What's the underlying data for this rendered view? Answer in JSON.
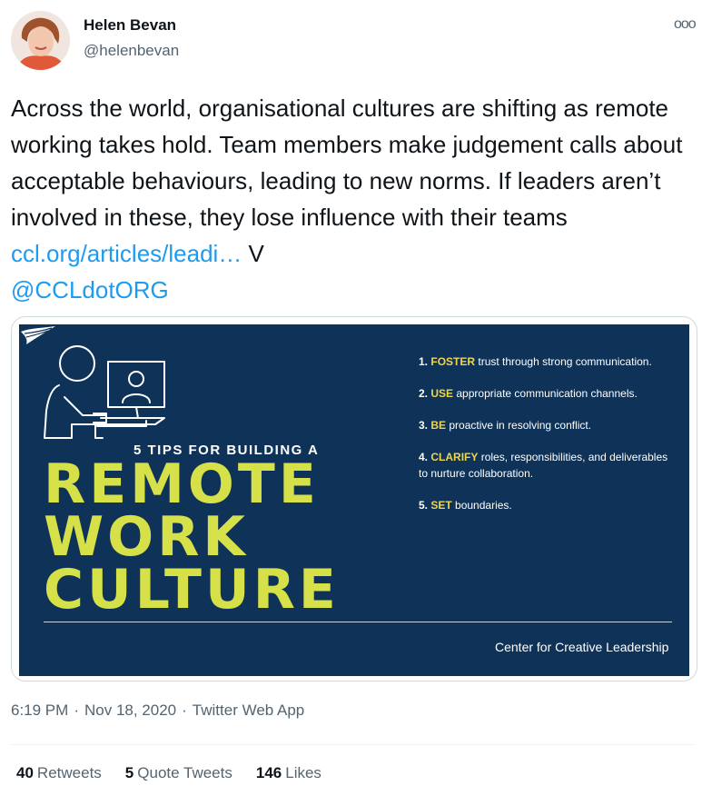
{
  "author": {
    "name": "Helen Bevan",
    "handle": "@helenbevan"
  },
  "more_menu_glyph": "ooo",
  "tweet": {
    "text": "Across the world, organisational cultures are shifting as remote working takes hold. Team members make judgement calls about acceptable behaviours, leading to new norms. If leaders aren’t involved in these, they lose influence with their teams ",
    "link_text": "ccl.org/articles/leadi…",
    "after_link": " V",
    "mention": "@CCLdotORG"
  },
  "media": {
    "subtitle": "5 TIPS FOR BUILDING A",
    "headline": [
      "REMOTE",
      "WORK",
      "CULTURE"
    ],
    "tips": [
      {
        "num": "1.",
        "keyword": "FOSTER",
        "text": " trust through strong communication."
      },
      {
        "num": "2.",
        "keyword": "USE",
        "text": " appropriate communication channels."
      },
      {
        "num": "3.",
        "keyword": "BE",
        "text": " proactive in resolving conflict."
      },
      {
        "num": "4.",
        "keyword": "CLARIFY",
        "text": " roles, responsibilities, and deliverables to nurture collaboration."
      },
      {
        "num": "5.",
        "keyword": "SET",
        "text": " boundaries."
      }
    ],
    "brand": "Center for Creative Leadership",
    "colors": {
      "background": "#0f3358",
      "headline": "#d6e049",
      "keyword": "#f0d54a"
    }
  },
  "meta": {
    "time": "6:19 PM",
    "date": "Nov 18, 2020",
    "source": "Twitter Web App"
  },
  "stats": {
    "retweets_count": "40",
    "retweets_label": "Retweets",
    "quotes_count": "5",
    "quotes_label": "Quote Tweets",
    "likes_count": "146",
    "likes_label": "Likes"
  },
  "colors": {
    "link": "#1d9bf0",
    "secondary_text": "#536471"
  }
}
